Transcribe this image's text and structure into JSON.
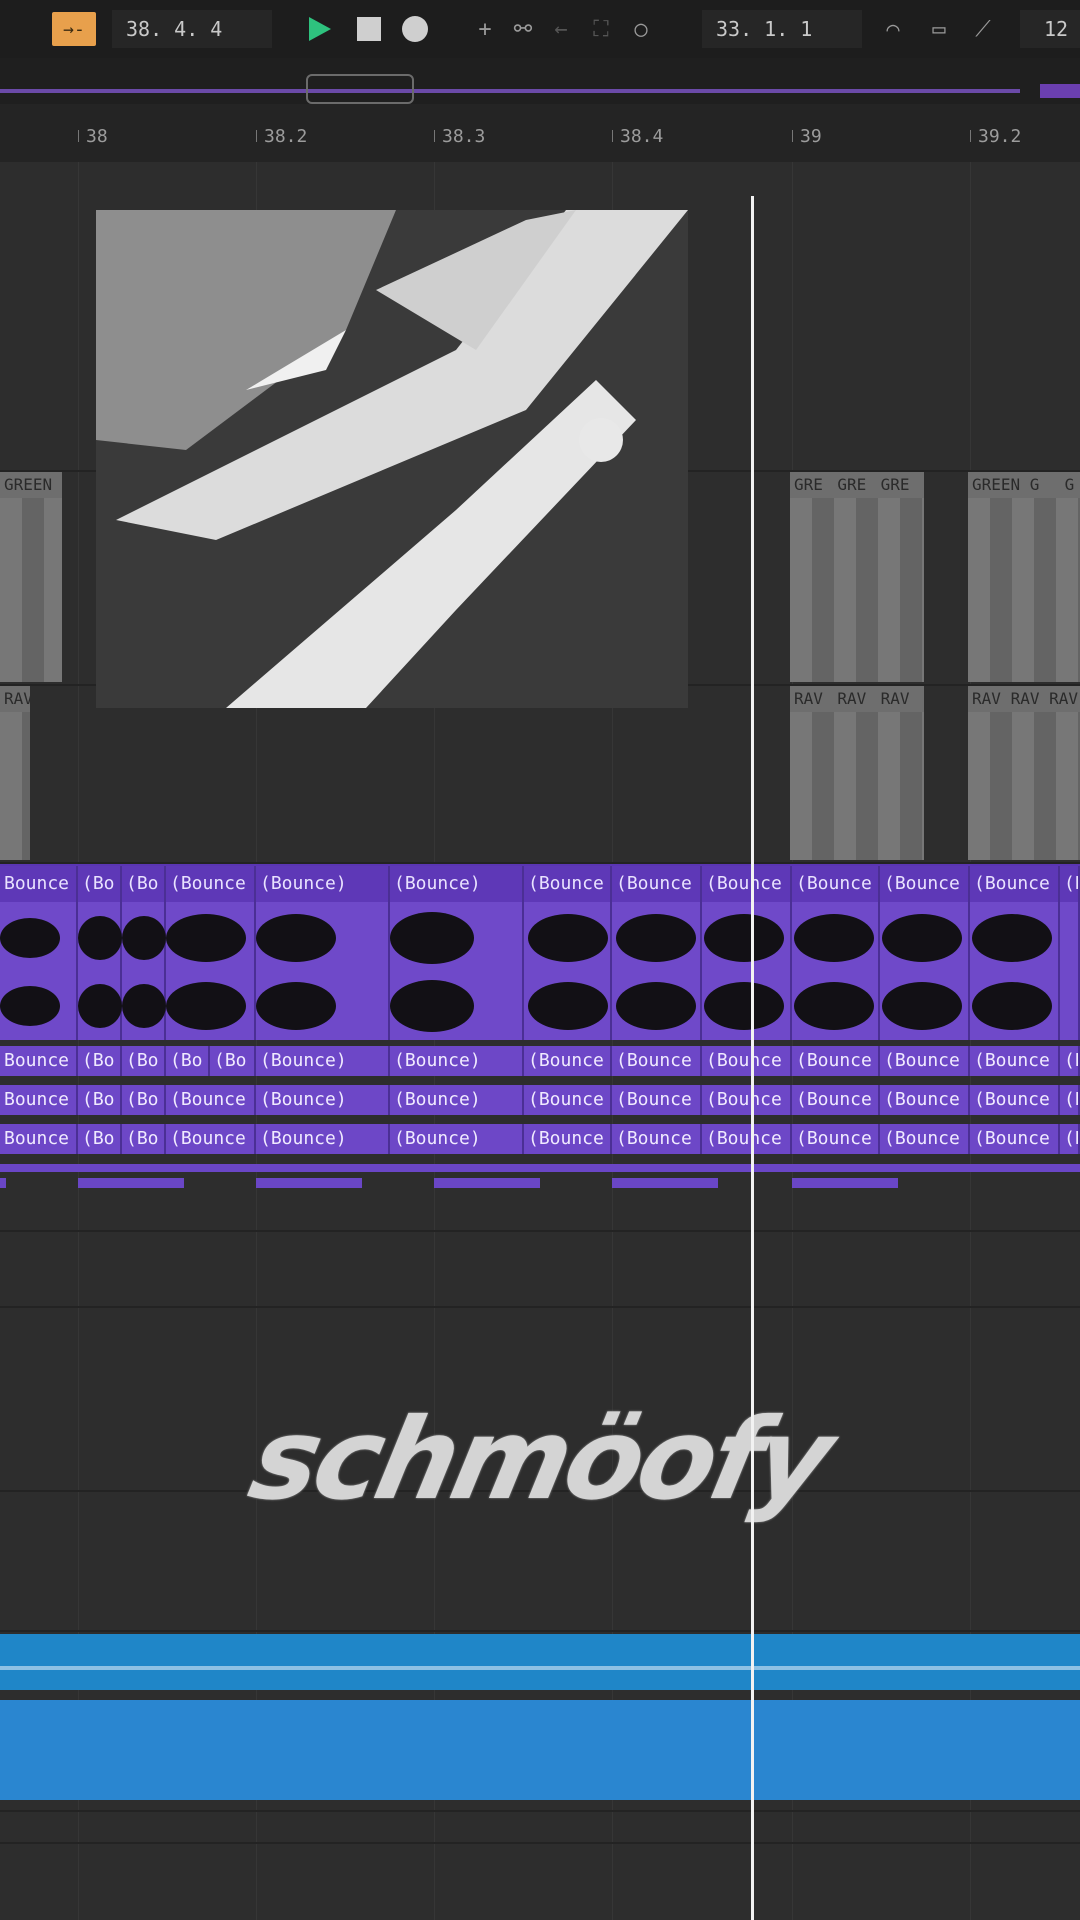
{
  "transport": {
    "arrangement_position": "38.  4.  4",
    "loop_start": "33.  1.  1",
    "loop_length_partial": "12",
    "icons": [
      "follow-icon",
      "play-icon",
      "stop-icon",
      "record-icon",
      "add-icon",
      "link-icon",
      "back-arrow-icon",
      "loop-area-icon",
      "circle-icon",
      "curve-icon",
      "draw-icon",
      "automation-icon"
    ]
  },
  "ruler": {
    "labels": [
      "38",
      "38.2",
      "38.3",
      "38.4",
      "39",
      "39.2"
    ]
  },
  "tracks": {
    "grey_clip_labels_left": [
      "GREEN",
      "RAV"
    ],
    "grey_clip_labels_right_a": [
      "GRE",
      "GRE",
      "GRE"
    ],
    "grey_clip_labels_right_b": [
      "GREEN G",
      "G"
    ],
    "grey_clip_labels_right_c": [
      "RAV",
      "RAV",
      "RAV"
    ],
    "grey_clip_labels_right_d": [
      "RAV",
      "RAV",
      "RAV"
    ],
    "purple_main_labels": [
      "Bounce",
      "(Bo",
      "(Bo",
      "(Bounce",
      "(Bounce)",
      "(Bounce)",
      "(Bounce",
      "(Bounce",
      "(Bounce",
      "(Bounce",
      "(Bounce",
      "(Bounce",
      "(B"
    ],
    "purple_lane_1": [
      "Bounce",
      "(Bo",
      "(Bo",
      "(Bo",
      "(Bo",
      "(Bounce)",
      "(Bounce)",
      "(Bounce",
      "(Bounce",
      "(Bounce",
      "(Bounce",
      "(Bounce",
      "(Bounce",
      "(B"
    ],
    "purple_lane_2": [
      "Bounce",
      "(Bo",
      "(Bo",
      "(Bounce",
      "(Bounce)",
      "(Bounce)",
      "(Bounce",
      "(Bounce",
      "(Bounce",
      "(Bounce",
      "(Bounce",
      "(Bounce",
      "(B"
    ],
    "purple_lane_3": [
      "Bounce",
      "(Bo",
      "(Bo",
      "(Bounce",
      "(Bounce)",
      "(Bounce)",
      "(Bounce",
      "(Bounce",
      "(Bounce",
      "(Bounce",
      "(Bounce",
      "(Bounce",
      "(B"
    ]
  },
  "watermark": "schmöofy",
  "colors": {
    "accent_orange": "#e8a04c",
    "play_green": "#2ec27e",
    "clip_purple": "#6f49c9",
    "clip_blue": "#1f86c8"
  }
}
